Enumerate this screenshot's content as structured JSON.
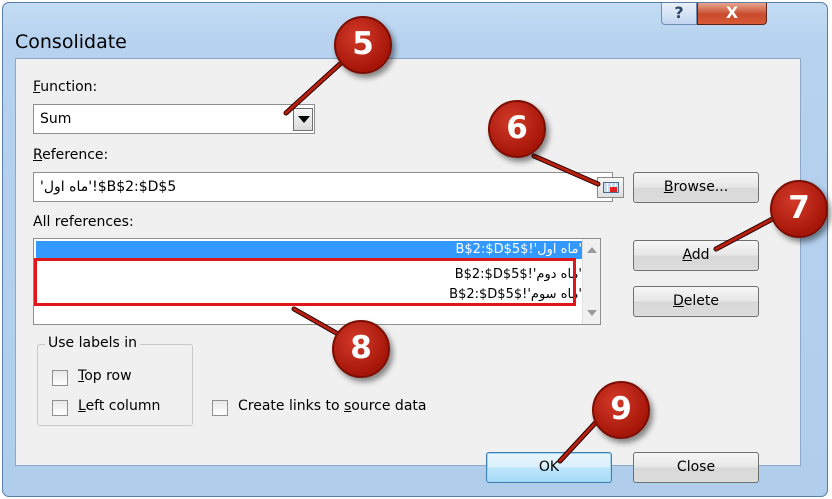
{
  "dialog": {
    "title": "Consolidate",
    "help_label": "?",
    "close_label": "X"
  },
  "function": {
    "label_accel": "F",
    "label_rest": "unction:",
    "value": "Sum"
  },
  "reference": {
    "label_accel": "R",
    "label_rest": "eference:",
    "value": "'ماه اول'!$B$2:$D$5"
  },
  "all_references": {
    "label": "All references:",
    "items": [
      "'ماه اول'!$B$2:$D$5",
      "'ماه دوم'!$B$2:$D$5",
      "'ماه سوم'!$B$2:$D$5"
    ],
    "selected_index": 0
  },
  "buttons": {
    "browse_accel": "B",
    "browse_rest": "rowse...",
    "add_accel": "A",
    "add_rest": "dd",
    "delete_accel": "D",
    "delete_rest": "elete",
    "ok": "OK",
    "close": "Close"
  },
  "use_labels": {
    "title": "Use labels in",
    "top_row_accel": "T",
    "top_row_rest": "op row",
    "left_column_accel": "L",
    "left_column_rest": "eft column",
    "top_row_checked": false,
    "left_column_checked": false
  },
  "create_links": {
    "label_pre": "Create links to ",
    "label_accel": "s",
    "label_rest": "ource data",
    "checked": false
  },
  "annotations": [
    "5",
    "6",
    "7",
    "8",
    "9"
  ],
  "colors": {
    "badge": "#b8200f",
    "highlight": "#e0161b",
    "selection": "#3399ff"
  }
}
